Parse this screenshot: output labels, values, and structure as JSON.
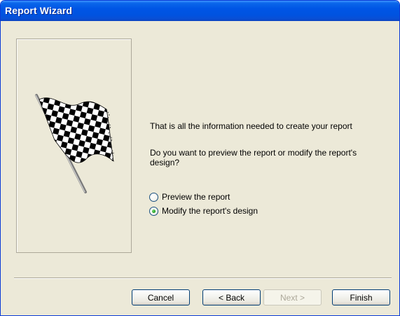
{
  "window": {
    "title": "Report Wizard"
  },
  "picture": {
    "icon": "checkered-flag-icon"
  },
  "messages": {
    "info": "That is all the information needed to create your report",
    "question": "Do you want to preview the report or modify the report's design?"
  },
  "options": [
    {
      "label": "Preview the report",
      "selected": false
    },
    {
      "label": "Modify the report's design",
      "selected": true
    }
  ],
  "buttons": {
    "cancel": "Cancel",
    "back": "< Back",
    "next": "Next >",
    "finish": "Finish"
  },
  "colors": {
    "titlebar": "#0055e5",
    "dialog_bg": "#ece9d8",
    "button_border": "#003c74",
    "disabled_text": "#aca899"
  }
}
